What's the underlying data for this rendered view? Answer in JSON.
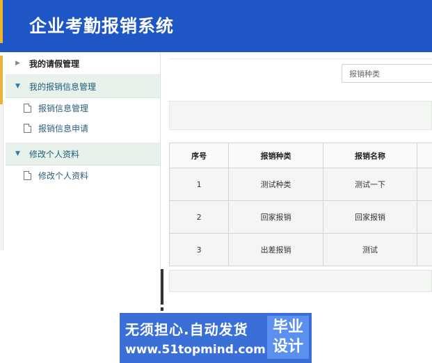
{
  "app": {
    "title": "企业考勤报销系统"
  },
  "sidebar": {
    "groups": [
      {
        "label": "我的请假管理",
        "expanded": false,
        "items": []
      },
      {
        "label": "我的报销信息管理",
        "expanded": true,
        "items": [
          {
            "label": "报销信息管理"
          },
          {
            "label": "报销信息申请"
          }
        ]
      },
      {
        "label": "修改个人资料",
        "expanded": true,
        "items": [
          {
            "label": "修改个人资料"
          }
        ]
      }
    ]
  },
  "filter": {
    "select_placeholder": "报销种类"
  },
  "table": {
    "headers": [
      "序号",
      "报销种类",
      "报销名称"
    ],
    "rows": [
      [
        "1",
        "测试种类",
        "测试一下"
      ],
      [
        "2",
        "回家报销",
        "回家报销"
      ],
      [
        "3",
        "出差报销",
        "测试"
      ]
    ]
  },
  "watermark": {
    "slogan": "无须担心.自动发货",
    "url": "www.51topmind.com",
    "badge_line1": "毕业",
    "badge_line2": "设计"
  },
  "colors": {
    "header_bg": "#1f56c6",
    "sidebar_active_bg": "#e8f1ea",
    "link_text": "#2c5d7c"
  },
  "icons": {
    "collapsed": "triangle-right-icon",
    "expanded": "triangle-down-icon",
    "item": "document-icon"
  }
}
